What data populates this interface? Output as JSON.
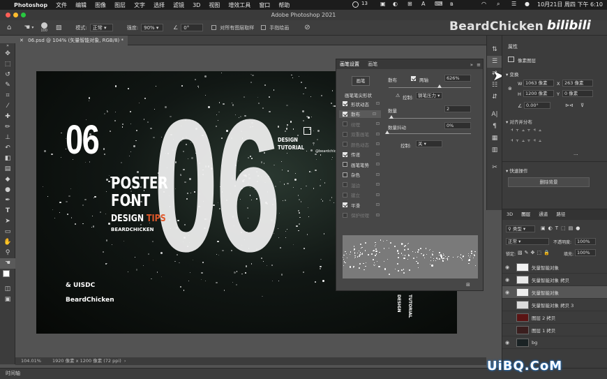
{
  "menubar": {
    "apple_icon": "apple-icon",
    "app_name": "Photoshop",
    "items": [
      "文件",
      "编辑",
      "图像",
      "图层",
      "文字",
      "选择",
      "滤镜",
      "3D",
      "视图",
      "增效工具",
      "窗口",
      "帮助"
    ],
    "status_count": "13",
    "datetime": "10月21日 周四 下午 6:10"
  },
  "window": {
    "title": "Adobe Photoshop 2021"
  },
  "options": {
    "brush_size": "100",
    "mode_label": "模式:",
    "mode_value": "正常",
    "strength_label": "强度:",
    "strength_value": "90%",
    "angle_value": "0°",
    "sample_all_label": "对所有图层取样",
    "finger_paint_label": "手指绘画"
  },
  "document": {
    "tab_label": "06.psd @ 104% (矢量智能对象, RGB/8) *",
    "zoom": "104.01%",
    "info": "1920 像素 x 1200 像素 (72 ppi)"
  },
  "poster": {
    "big_left": "06",
    "big_center": "06",
    "line1": "POSTER",
    "line2": "FONT",
    "design": "DESIGN",
    "tips": "TIPS",
    "author": "BEARDCHICKEN",
    "badge1": "DESIGN",
    "badge2": "TUTORIAL",
    "handle": "@beardchicken",
    "uisdc": "& UISDC",
    "bottom_name": "BeardChicken",
    "vertical1": "DESIGN",
    "vertical2": "TUTORIAL"
  },
  "brush_panel": {
    "tab_active": "画笔设置",
    "tab_other": "画笔",
    "brush_button": "画笔",
    "tip_shape": "画笔笔尖形状",
    "options": [
      {
        "label": "形状动态",
        "checked": true,
        "enabled": true
      },
      {
        "label": "散布",
        "checked": true,
        "enabled": true
      },
      {
        "label": "纹理",
        "checked": false,
        "enabled": false
      },
      {
        "label": "双重画笔",
        "checked": false,
        "enabled": false
      },
      {
        "label": "颜色动态",
        "checked": false,
        "enabled": false
      },
      {
        "label": "传递",
        "checked": true,
        "enabled": true
      },
      {
        "label": "画笔笔势",
        "checked": false,
        "enabled": true
      },
      {
        "label": "杂色",
        "checked": false,
        "enabled": true
      },
      {
        "label": "湿边",
        "checked": false,
        "enabled": false
      },
      {
        "label": "建立",
        "checked": false,
        "enabled": false
      },
      {
        "label": "平滑",
        "checked": true,
        "enabled": true
      },
      {
        "label": "保护纹理",
        "checked": false,
        "enabled": false
      }
    ],
    "scatter_label": "散布",
    "both_axes_label": "两轴",
    "scatter_value": "626%",
    "control_label": "控制:",
    "control_value": "钢笔压力",
    "count_label": "数量",
    "count_value": "2",
    "count_jitter_label": "数量抖动",
    "count_jitter_value": "0%",
    "control2_label": "控制:",
    "control2_value": "关"
  },
  "properties": {
    "title": "属性",
    "subtitle": "像素图层",
    "transform_label": "变换",
    "w_label": "W",
    "w_value": "1063 像素",
    "x_label": "X",
    "x_value": "263 像素",
    "h_label": "H",
    "h_value": "1200 像素",
    "y_label": "Y",
    "y_value": "0 像素",
    "angle_value": "0.00°",
    "align_label": "对齐并分布",
    "quick_label": "快速操作",
    "remove_bg": "删除背景"
  },
  "layers_panel": {
    "tabs": [
      "3D",
      "图层",
      "通道",
      "路径"
    ],
    "kind_value": "类型",
    "blend_value": "正常",
    "opacity_label": "不透明度:",
    "opacity_value": "100%",
    "lock_label": "锁定:",
    "fill_label": "填充:",
    "fill_value": "100%",
    "layers": [
      {
        "name": "矢量智能对象",
        "visible": true,
        "selected": false
      },
      {
        "name": "矢量智能对象 拷贝",
        "visible": true,
        "selected": false
      },
      {
        "name": "矢量智能对象",
        "visible": true,
        "selected": true
      },
      {
        "name": "矢量智能对象 拷贝 3",
        "visible": false,
        "selected": false
      },
      {
        "name": "图层 2 拷贝",
        "visible": false,
        "selected": false
      },
      {
        "name": "图层 1 拷贝",
        "visible": false,
        "selected": false
      },
      {
        "name": "bg",
        "visible": true,
        "selected": false
      }
    ]
  },
  "timeline_label": "时间轴",
  "watermarks": {
    "channel": "BeardChicken",
    "bili": "bilibili",
    "site": "UiBQ.CoM"
  }
}
